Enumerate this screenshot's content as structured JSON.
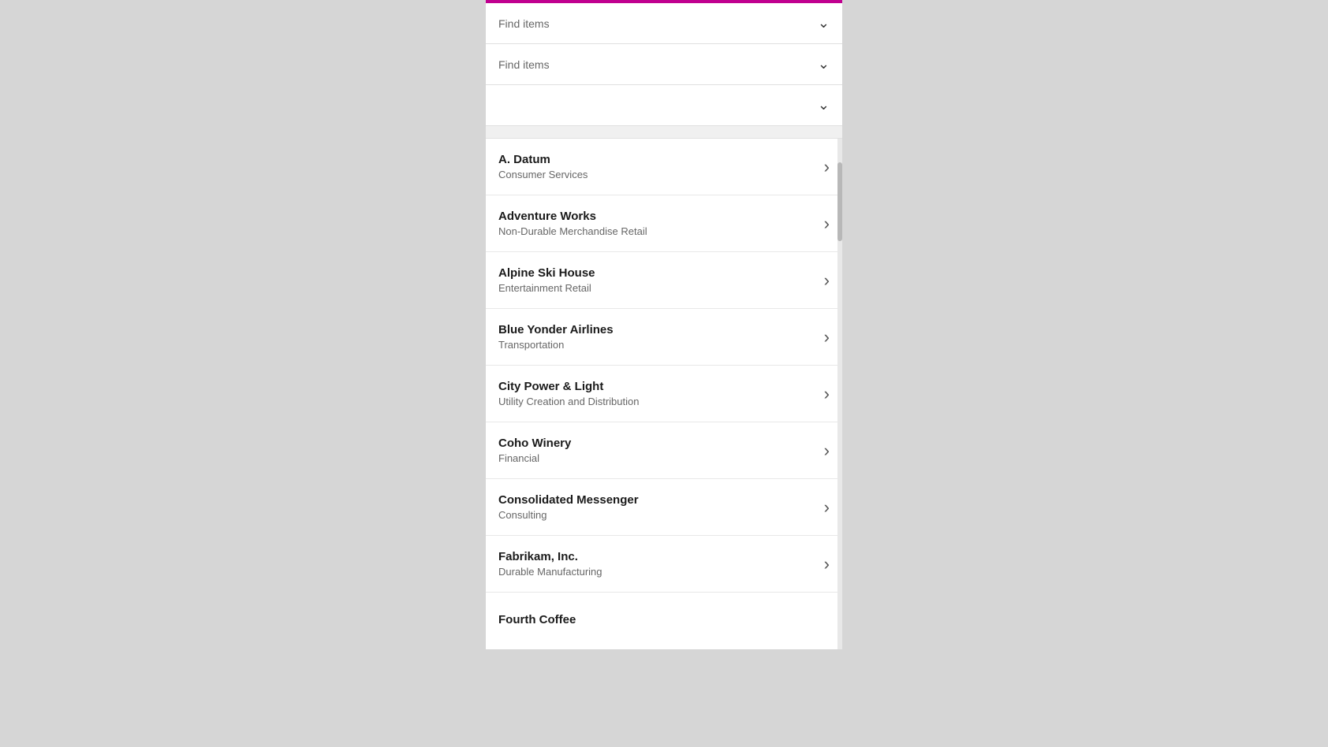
{
  "dropdowns": [
    {
      "id": "dropdown-1",
      "placeholder": "Find items",
      "value": "Find items"
    },
    {
      "id": "dropdown-2",
      "placeholder": "Find items",
      "value": "Find items"
    },
    {
      "id": "dropdown-3",
      "placeholder": "",
      "value": ""
    }
  ],
  "items": [
    {
      "id": "a-datum",
      "title": "A. Datum",
      "subtitle": "Consumer Services"
    },
    {
      "id": "adventure-works",
      "title": "Adventure Works",
      "subtitle": "Non-Durable Merchandise Retail"
    },
    {
      "id": "alpine-ski-house",
      "title": "Alpine Ski House",
      "subtitle": "Entertainment Retail"
    },
    {
      "id": "blue-yonder-airlines",
      "title": "Blue Yonder Airlines",
      "subtitle": "Transportation"
    },
    {
      "id": "city-power-light",
      "title": "City Power & Light",
      "subtitle": "Utility Creation and Distribution"
    },
    {
      "id": "coho-winery",
      "title": "Coho Winery",
      "subtitle": "Financial"
    },
    {
      "id": "consolidated-messenger",
      "title": "Consolidated Messenger",
      "subtitle": "Consulting"
    },
    {
      "id": "fabrikam-inc",
      "title": "Fabrikam, Inc.",
      "subtitle": "Durable Manufacturing"
    },
    {
      "id": "fourth-coffee",
      "title": "Fourth Coffee",
      "subtitle": ""
    }
  ],
  "icons": {
    "chevron_down": "⌄",
    "chevron_right": "›"
  }
}
